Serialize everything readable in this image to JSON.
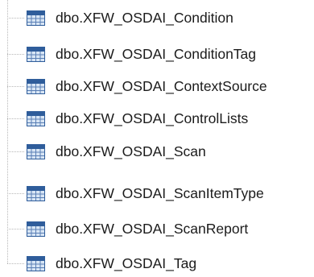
{
  "tree": {
    "items": [
      {
        "label": "dbo.XFW_OSDAI_Condition",
        "icon": "table-icon"
      },
      {
        "label": "dbo.XFW_OSDAI_ConditionTag",
        "icon": "table-icon"
      },
      {
        "label": "dbo.XFW_OSDAI_ContextSource",
        "icon": "table-icon"
      },
      {
        "label": "dbo.XFW_OSDAI_ControlLists",
        "icon": "table-icon"
      },
      {
        "label": "dbo.XFW_OSDAI_Scan",
        "icon": "table-icon"
      },
      {
        "label": "dbo.XFW_OSDAI_ScanItemType",
        "icon": "table-icon"
      },
      {
        "label": "dbo.XFW_OSDAI_ScanReport",
        "icon": "table-icon"
      },
      {
        "label": "dbo.XFW_OSDAI_Tag",
        "icon": "table-icon"
      }
    ]
  },
  "colors": {
    "icon_header": "#2f5d9b",
    "icon_body": "#d8e6f5",
    "icon_grid": "#5a7fb5",
    "tree_line": "#b8b8b8",
    "text": "#1b1b1b"
  }
}
